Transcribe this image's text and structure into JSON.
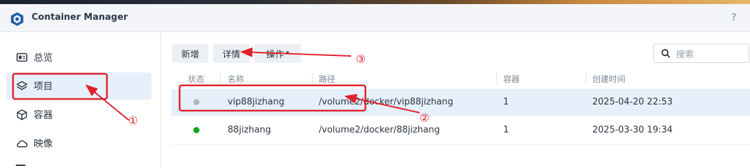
{
  "app": {
    "title": "Container Manager",
    "help_label": "?"
  },
  "sidebar": {
    "items": [
      {
        "label": "总览",
        "icon": "overview-icon"
      },
      {
        "label": "项目",
        "icon": "layers-icon",
        "active": true
      },
      {
        "label": "容器",
        "icon": "cube-icon"
      },
      {
        "label": "映像",
        "icon": "cloud-icon"
      }
    ]
  },
  "toolbar": {
    "create_label": "新增",
    "details_label": "详情",
    "actions_label": "操作",
    "actions_caret": "▾",
    "search_placeholder": "搜索"
  },
  "table": {
    "headers": {
      "status": "状态",
      "name": "名称",
      "path": "路径",
      "containers": "容器",
      "created": "创建时间"
    },
    "rows": [
      {
        "status": "stopped",
        "status_color": "#b3b8bf",
        "name": "vip88jizhang",
        "path": "/volume2/docker/vip88jizhang",
        "containers": "1",
        "created": "2025-04-20 22:53",
        "selected": true
      },
      {
        "status": "running",
        "status_color": "#16a31a",
        "name": "88jizhang",
        "path": "/volume2/docker/88jizhang",
        "containers": "1",
        "created": "2025-03-30 19:34",
        "selected": false
      }
    ]
  },
  "annotations": {
    "one": "①",
    "two": "②",
    "three": "③",
    "color": "#e0202b"
  }
}
